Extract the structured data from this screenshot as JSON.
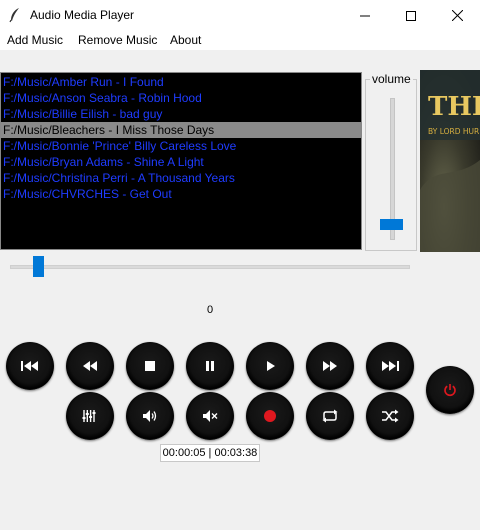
{
  "window": {
    "title": "Audio Media Player",
    "minimize_icon": "minimize-icon",
    "maximize_icon": "maximize-icon",
    "close_icon": "close-icon"
  },
  "menu": {
    "add_music": "Add Music",
    "remove_music": "Remove Music",
    "about": "About"
  },
  "playlist": {
    "items": [
      "F:/Music/Amber Run - I Found",
      "F:/Music/Anson Seabra - Robin Hood",
      "F:/Music/Billie Eilish - bad guy",
      "F:/Music/Bleachers - I Miss Those Days",
      "F:/Music/Bonnie 'Prince' Billy Careless Love",
      "F:/Music/Bryan Adams - Shine A Light",
      "F:/Music/Christina Perri - A Thousand Years",
      "F:/Music/CHVRCHES - Get Out"
    ],
    "selected_index": 3,
    "item_color": "#1f3cff",
    "selected_bg": "#8a8a8a"
  },
  "volume": {
    "label": "volume",
    "level": 0.08
  },
  "album_art": {
    "title_text": "THE",
    "byline": "BY LORD HUR"
  },
  "seek": {
    "position_fraction": 0.06,
    "value_label": "0"
  },
  "controls": {
    "row1": [
      "skip-back-icon",
      "rewind-icon",
      "stop-icon",
      "pause-icon",
      "play-icon",
      "fast-forward-icon",
      "skip-forward-icon"
    ],
    "row2": [
      "equalizer-icon",
      "volume-up-icon",
      "mute-icon",
      "record-icon",
      "repeat-icon",
      "shuffle-icon"
    ],
    "power": "power-icon",
    "accent": "#e0181f"
  },
  "time": {
    "elapsed": "00:00:05",
    "separator": " | ",
    "total": "00:03:38"
  },
  "colors": {
    "accent_blue": "#0078d7",
    "background": "#f0f0f0"
  }
}
